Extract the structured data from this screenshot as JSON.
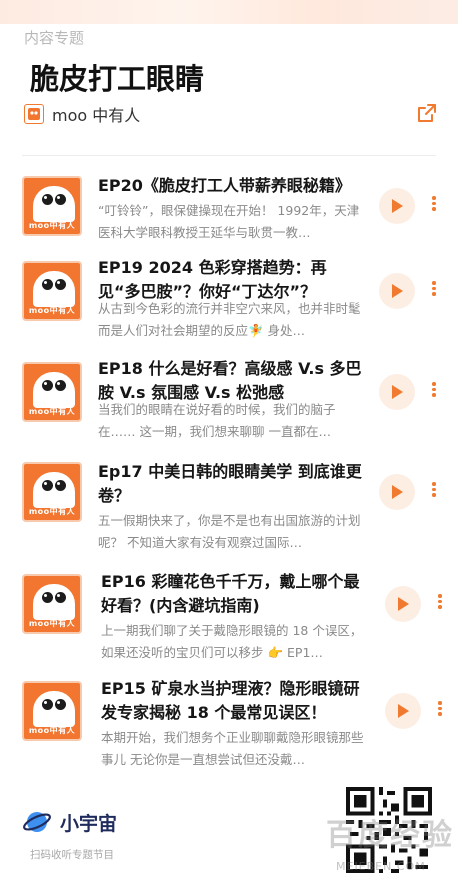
{
  "header": {
    "section_label": "内容专题",
    "title": "脆皮打工眼睛",
    "author_name": "moo 中有人"
  },
  "cover_label": "moo中有人",
  "episodes": [
    {
      "title": "EP20《脆皮打工人带薪养眼秘籍》",
      "description": "“叮铃铃”，眼保健操现在开始！ 1992年，天津医科大学眼科教授王延华与耿贯一教…"
    },
    {
      "title": "EP19 2024 色彩穿搭趋势：再见“多巴胺”？你好“丁达尔”？",
      "description": "从古到今色彩的流行并非空穴来风，也并非时髦 而是人们对社会期望的反应🧚 身处…"
    },
    {
      "title": "EP18 什么是好看？高级感 V.s 多巴胺 V.s 氛围感 V.s 松弛感",
      "description": "当我们的眼睛在说好看的时候，我们的脑子在…… 这一期，我们想来聊聊 一直都在…"
    },
    {
      "title": "Ep17 中美日韩的眼睛美学 到底谁更卷？",
      "description": "五一假期快来了，你是不是也有出国旅游的计划呢？ 不知道大家有没有观察过国际…"
    },
    {
      "title": "EP16 彩瞳花色千千万，戴上哪个最好看？(内含避坑指南)",
      "description": "上一期我们聊了关于戴隐形眼镜的 18 个误区，如果还没听的宝贝们可以移步 👉 EP1…"
    },
    {
      "title": "EP15 矿泉水当护理液？隐形眼镜研发专家揭秘 18 个最常见误区！",
      "description": "本期开始，我们想务个正业聊聊戴隐形眼镜那些事儿 无论你是一直想尝试但还没戴…"
    }
  ],
  "footer": {
    "brand_name": "小宇宙",
    "brand_sub": "扫码收听专题节目",
    "watermark": "百度经验",
    "watermark_sub": "MEIEBEN.COM"
  },
  "colors": {
    "accent": "#f07a2f",
    "cover_bg": "#f27630",
    "play_bg": "#fdeee4"
  },
  "icons": [
    "share-icon",
    "play-icon",
    "more-vertical-icon",
    "planet-icon",
    "qr-code"
  ]
}
